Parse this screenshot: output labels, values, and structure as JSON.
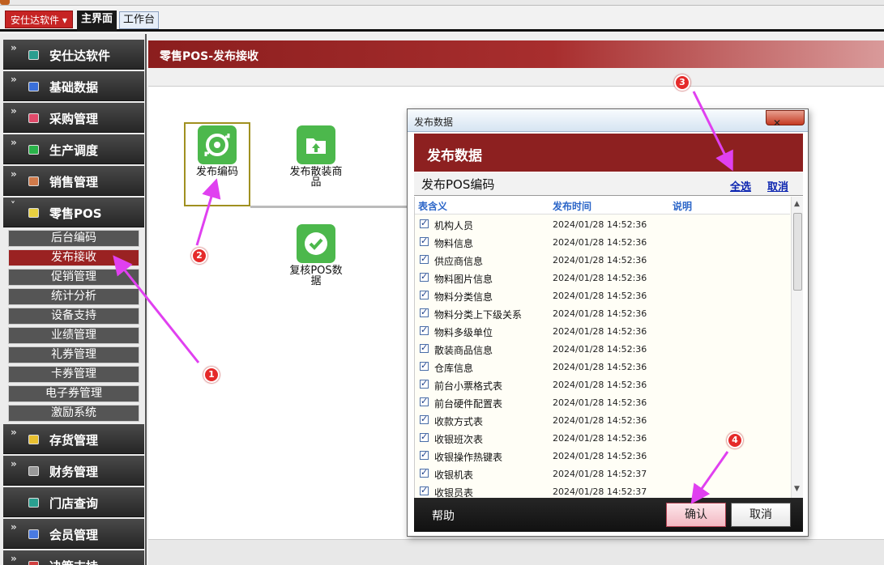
{
  "top": {
    "company_button": "安仕达软件 ▾",
    "tabs": [
      "主界面",
      "工作台"
    ]
  },
  "sidebar": {
    "sections": [
      {
        "label": "安仕达软件",
        "icon": "teal-cube-icon",
        "color": "#2a9d8f"
      },
      {
        "label": "基础数据",
        "icon": "blue-box-icon",
        "color": "#3a6fd8"
      },
      {
        "label": "采购管理",
        "icon": "red-box-icon",
        "color": "#e04a6a"
      },
      {
        "label": "生产调度",
        "icon": "green-box-icon",
        "color": "#2ab34a"
      },
      {
        "label": "销售管理",
        "icon": "orange-box-icon",
        "color": "#d07a4a"
      },
      {
        "label": "零售POS",
        "icon": "yellow-box-icon",
        "color": "#e8d040"
      },
      {
        "label": "存货管理",
        "icon": "yellow-box-icon",
        "color": "#e8c030"
      },
      {
        "label": "财务管理",
        "icon": "gray-box-icon",
        "color": "#999999"
      },
      {
        "label": "门店查询",
        "icon": "teal-box-icon",
        "color": "#2aa090"
      },
      {
        "label": "会员管理",
        "icon": "blue-box-icon",
        "color": "#4a7ae0"
      },
      {
        "label": "决策支持",
        "icon": "red-box-icon",
        "color": "#d04040"
      }
    ],
    "subitems": [
      "后台编码",
      "发布接收",
      "促销管理",
      "统计分析",
      "设备支持",
      "业绩管理",
      "礼券管理",
      "卡券管理",
      "电子券管理",
      "激励系统"
    ],
    "active_subitem": "发布接收"
  },
  "page": {
    "breadcrumb": "零售POS-发布接收",
    "tiles": [
      {
        "label": "发布编码",
        "icon": "sync-arrows-icon"
      },
      {
        "label": "发布散装商品",
        "icon": "folder-upload-icon"
      },
      {
        "label": "复核POS数据",
        "icon": "check-circle-icon"
      }
    ]
  },
  "dialog": {
    "window_title": "发布数据",
    "header": "发布数据",
    "subtitle": "发布POS编码",
    "select_all": "全选",
    "cancel_select": "取消",
    "columns": [
      "表含义",
      "发布时间",
      "说明"
    ],
    "rows": [
      {
        "name": "机构人员",
        "time": "2024/01/28 14:52:36",
        "note": "",
        "checked": true
      },
      {
        "name": "物料信息",
        "time": "2024/01/28 14:52:36",
        "note": "",
        "checked": true
      },
      {
        "name": "供应商信息",
        "time": "2024/01/28 14:52:36",
        "note": "",
        "checked": true
      },
      {
        "name": "物料图片信息",
        "time": "2024/01/28 14:52:36",
        "note": "",
        "checked": true
      },
      {
        "name": "物料分类信息",
        "time": "2024/01/28 14:52:36",
        "note": "",
        "checked": true
      },
      {
        "name": "物料分类上下级关系",
        "time": "2024/01/28 14:52:36",
        "note": "",
        "checked": true
      },
      {
        "name": "物料多级单位",
        "time": "2024/01/28 14:52:36",
        "note": "",
        "checked": true
      },
      {
        "name": "散装商品信息",
        "time": "2024/01/28 14:52:36",
        "note": "",
        "checked": true
      },
      {
        "name": "仓库信息",
        "time": "2024/01/28 14:52:36",
        "note": "",
        "checked": true
      },
      {
        "name": "前台小票格式表",
        "time": "2024/01/28 14:52:36",
        "note": "",
        "checked": true
      },
      {
        "name": "前台硬件配置表",
        "time": "2024/01/28 14:52:36",
        "note": "",
        "checked": true
      },
      {
        "name": "收款方式表",
        "time": "2024/01/28 14:52:36",
        "note": "",
        "checked": true
      },
      {
        "name": "收银班次表",
        "time": "2024/01/28 14:52:36",
        "note": "",
        "checked": true
      },
      {
        "name": "收银操作热键表",
        "time": "2024/01/28 14:52:36",
        "note": "",
        "checked": true
      },
      {
        "name": "收银机表",
        "time": "2024/01/28 14:52:37",
        "note": "",
        "checked": true
      },
      {
        "name": "收银员表",
        "time": "2024/01/28 14:52:37",
        "note": "",
        "checked": true
      }
    ],
    "help": "帮助",
    "ok": "确认",
    "cancel": "取消"
  },
  "annotations": {
    "badges": [
      "1",
      "2",
      "3",
      "4"
    ],
    "arrow_color": "#e040f0",
    "badge_color": "#e52a2a"
  }
}
